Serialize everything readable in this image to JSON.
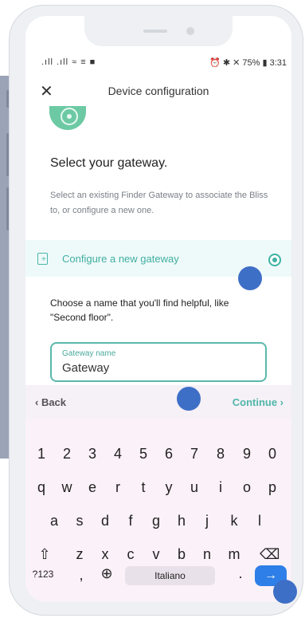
{
  "status_bar": {
    "left": ".ıll .ıll ≈ ≡ ■",
    "right": "⏰ ✱ ✕ 75% ▮ 3:31"
  },
  "header": {
    "title": "Device configuration",
    "close_icon": "close-icon"
  },
  "content": {
    "heading": "Select your gateway.",
    "description": "Select an existing Finder Gateway to associate the Bliss to, or configure a new one.",
    "option_label": "Configure a new gateway",
    "prompt": "Choose a name that you'll find helpful, like \"Second floor\".",
    "field_label": "Gateway name",
    "field_value": "Gateway"
  },
  "accessory": {
    "back_label": "‹ Back",
    "continue_label": "Continue ›"
  },
  "keyboard": {
    "numbers": [
      "1",
      "2",
      "3",
      "4",
      "5",
      "6",
      "7",
      "8",
      "9",
      "0"
    ],
    "row1": [
      "q",
      "w",
      "e",
      "r",
      "t",
      "y",
      "u",
      "i",
      "o",
      "p"
    ],
    "row2": [
      "a",
      "s",
      "d",
      "f",
      "g",
      "h",
      "j",
      "k",
      "l"
    ],
    "row3": [
      "z",
      "x",
      "c",
      "v",
      "b",
      "n",
      "m"
    ],
    "shift": "⇧",
    "backspace": "⌫",
    "symbols_label": "?123",
    "comma": ",",
    "globe": "⊕",
    "space_label": "Italiano",
    "period": ".",
    "enter": "→"
  },
  "colors": {
    "accent": "#4fb7a9",
    "marker": "#3e6fc6",
    "enter": "#2e7fe8"
  }
}
